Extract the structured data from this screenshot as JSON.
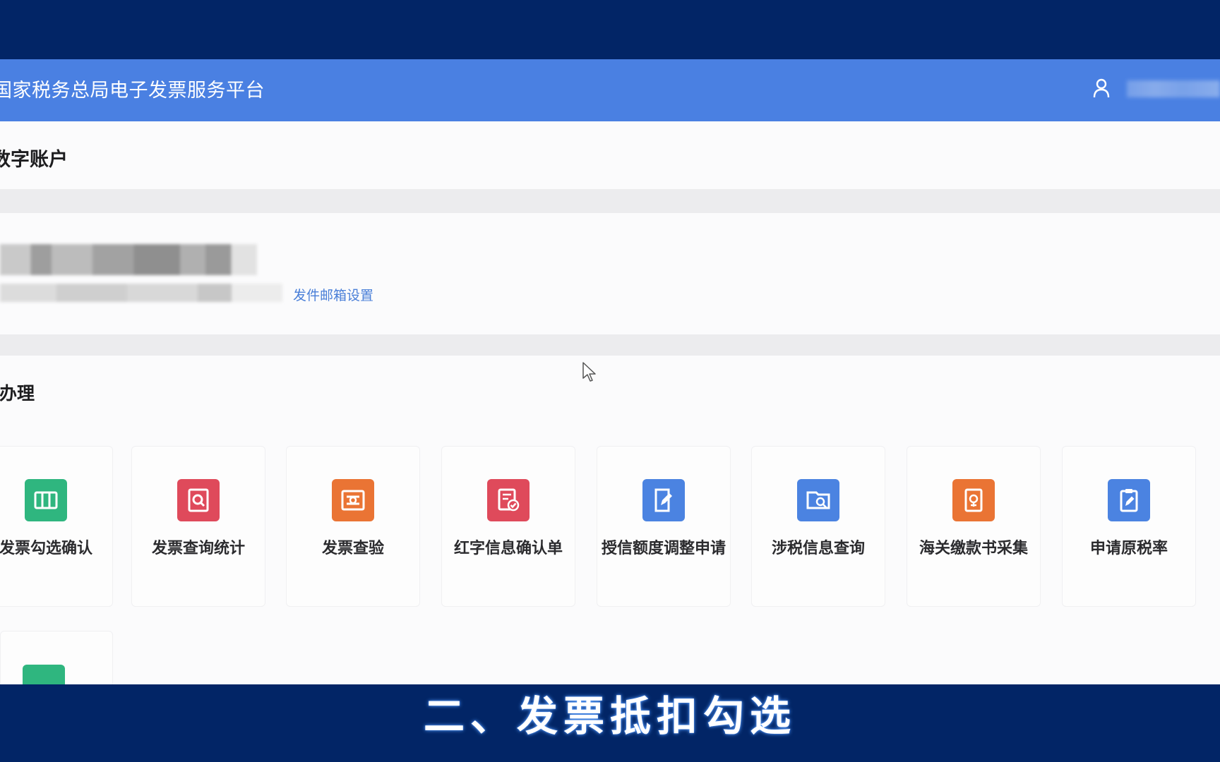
{
  "header": {
    "platform_title": "国家税务总局电子发票服务平台",
    "user_icon": "user-icon"
  },
  "account_section": {
    "title": "数字账户",
    "email_settings_link": "发件邮箱设置"
  },
  "services_section": {
    "title": "务办理",
    "cards": [
      {
        "label": "发票勾选确认",
        "icon": "ticket-icon",
        "color": "#2fb67f"
      },
      {
        "label": "发票查询统计",
        "icon": "search-document-icon",
        "color": "#df4a5b"
      },
      {
        "label": "发票查验",
        "icon": "invoice-check-icon",
        "color": "#ea7434"
      },
      {
        "label": "红字信息确认单",
        "icon": "document-check-icon",
        "color": "#df4a5b"
      },
      {
        "label": "授信额度调整申请",
        "icon": "edit-document-icon",
        "color": "#4b83e1"
      },
      {
        "label": "涉税信息查询",
        "icon": "folder-search-icon",
        "color": "#4b83e1"
      },
      {
        "label": "海关缴款书采集",
        "icon": "customs-receipt-icon",
        "color": "#ea7434"
      },
      {
        "label": "申请原税率",
        "icon": "clipboard-edit-icon",
        "color": "#4b83e1"
      }
    ]
  },
  "caption": "二、发票抵扣勾选"
}
